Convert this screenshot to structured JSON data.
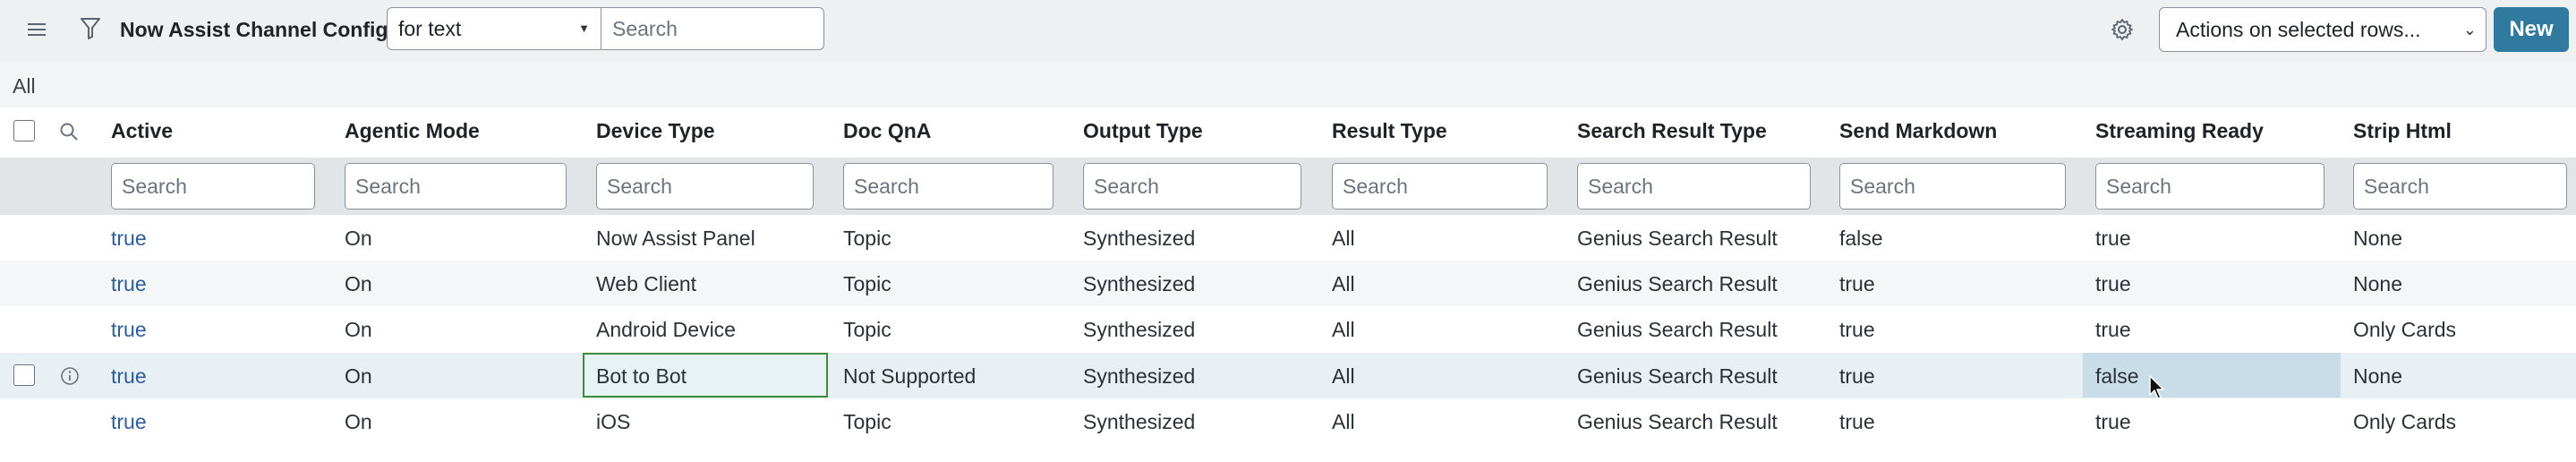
{
  "toolbar": {
    "title": "Now Assist Channel Configs",
    "filter_field": "for text",
    "search_placeholder": "Search",
    "actions_label": "Actions on selected rows...",
    "new_label": "New"
  },
  "breadcrumb": "All",
  "columns": [
    {
      "label": "Active",
      "search": "Search"
    },
    {
      "label": "Agentic Mode",
      "search": "Search"
    },
    {
      "label": "Device Type",
      "search": "Search"
    },
    {
      "label": "Doc QnA",
      "search": "Search"
    },
    {
      "label": "Output Type",
      "search": "Search"
    },
    {
      "label": "Result Type",
      "search": "Search"
    },
    {
      "label": "Search Result Type",
      "search": "Search"
    },
    {
      "label": "Send Markdown",
      "search": "Search"
    },
    {
      "label": "Streaming Ready",
      "search": "Search"
    },
    {
      "label": "Strip Html",
      "search": "Search"
    }
  ],
  "rows": [
    [
      "true",
      "On",
      "Now Assist Panel",
      "Topic",
      "Synthesized",
      "All",
      "Genius Search Result",
      "false",
      "true",
      "None"
    ],
    [
      "true",
      "On",
      "Web Client",
      "Topic",
      "Synthesized",
      "All",
      "Genius Search Result",
      "true",
      "true",
      "None"
    ],
    [
      "true",
      "On",
      "Android Device",
      "Topic",
      "Synthesized",
      "All",
      "Genius Search Result",
      "true",
      "true",
      "Only Cards"
    ],
    [
      "true",
      "On",
      "Bot to Bot",
      "Not Supported",
      "Synthesized",
      "All",
      "Genius Search Result",
      "true",
      "false",
      "None"
    ],
    [
      "true",
      "On",
      "iOS",
      "Topic",
      "Synthesized",
      "All",
      "Genius Search Result",
      "true",
      "true",
      "Only Cards"
    ]
  ],
  "colors": {
    "link": "#2e5c9a",
    "new_button": "#2f7a9e",
    "selected_cell_border": "#3c8a3c"
  }
}
